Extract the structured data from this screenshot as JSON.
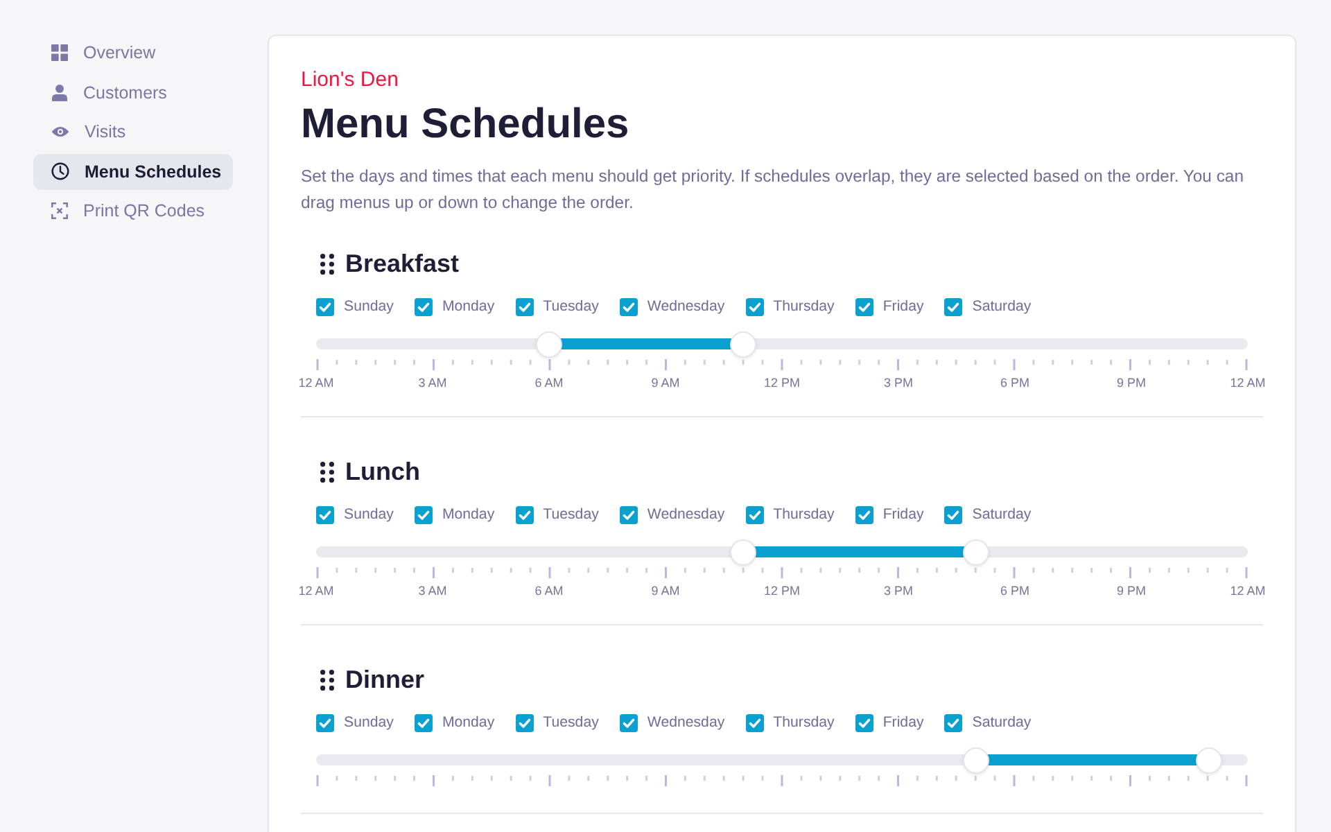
{
  "sidebar": {
    "items": [
      {
        "label": "Overview",
        "selected": false
      },
      {
        "label": "Customers",
        "selected": false
      },
      {
        "label": "Visits",
        "selected": false
      },
      {
        "label": "Menu Schedules",
        "selected": true
      },
      {
        "label": "Print QR Codes",
        "selected": false
      }
    ]
  },
  "page": {
    "restaurant": "Lion's Den",
    "title": "Menu Schedules",
    "description": "Set the days and times that each menu should get priority. If schedules overlap, they are selected based on the order. You can drag menus up or down to change the order."
  },
  "schedules": [
    {
      "name": "Breakfast",
      "days": [
        {
          "label": "Sunday",
          "checked": true
        },
        {
          "label": "Monday",
          "checked": true
        },
        {
          "label": "Tuesday",
          "checked": true
        },
        {
          "label": "Wednesday",
          "checked": true
        },
        {
          "label": "Thursday",
          "checked": true
        },
        {
          "label": "Friday",
          "checked": true
        },
        {
          "label": "Saturday",
          "checked": true
        }
      ],
      "range": {
        "start": {
          "level": 0.25
        },
        "end": {
          "level": 0.458
        }
      },
      "time_labels": [
        "12 AM",
        "3 AM",
        "6 AM",
        "9 AM",
        "12 PM",
        "3 PM",
        "6 PM",
        "9 PM",
        "12 AM"
      ]
    },
    {
      "name": "Lunch",
      "days": [
        {
          "label": "Sunday",
          "checked": true
        },
        {
          "label": "Monday",
          "checked": true
        },
        {
          "label": "Tuesday",
          "checked": true
        },
        {
          "label": "Wednesday",
          "checked": true
        },
        {
          "label": "Thursday",
          "checked": true
        },
        {
          "label": "Friday",
          "checked": true
        },
        {
          "label": "Saturday",
          "checked": true
        }
      ],
      "range": {
        "start": {
          "level": 0.458
        },
        "end": {
          "level": 0.708
        }
      },
      "time_labels": [
        "12 AM",
        "3 AM",
        "6 AM",
        "9 AM",
        "12 PM",
        "3 PM",
        "6 PM",
        "9 PM",
        "12 AM"
      ]
    },
    {
      "name": "Dinner",
      "days": [
        {
          "label": "Sunday",
          "checked": true
        },
        {
          "label": "Monday",
          "checked": true
        },
        {
          "label": "Tuesday",
          "checked": true
        },
        {
          "label": "Wednesday",
          "checked": true
        },
        {
          "label": "Thursday",
          "checked": true
        },
        {
          "label": "Friday",
          "checked": true
        },
        {
          "label": "Saturday",
          "checked": true
        }
      ],
      "range": {
        "start": {
          "level": 0.708
        },
        "end": {
          "level": 0.958
        }
      }
    }
  ]
}
